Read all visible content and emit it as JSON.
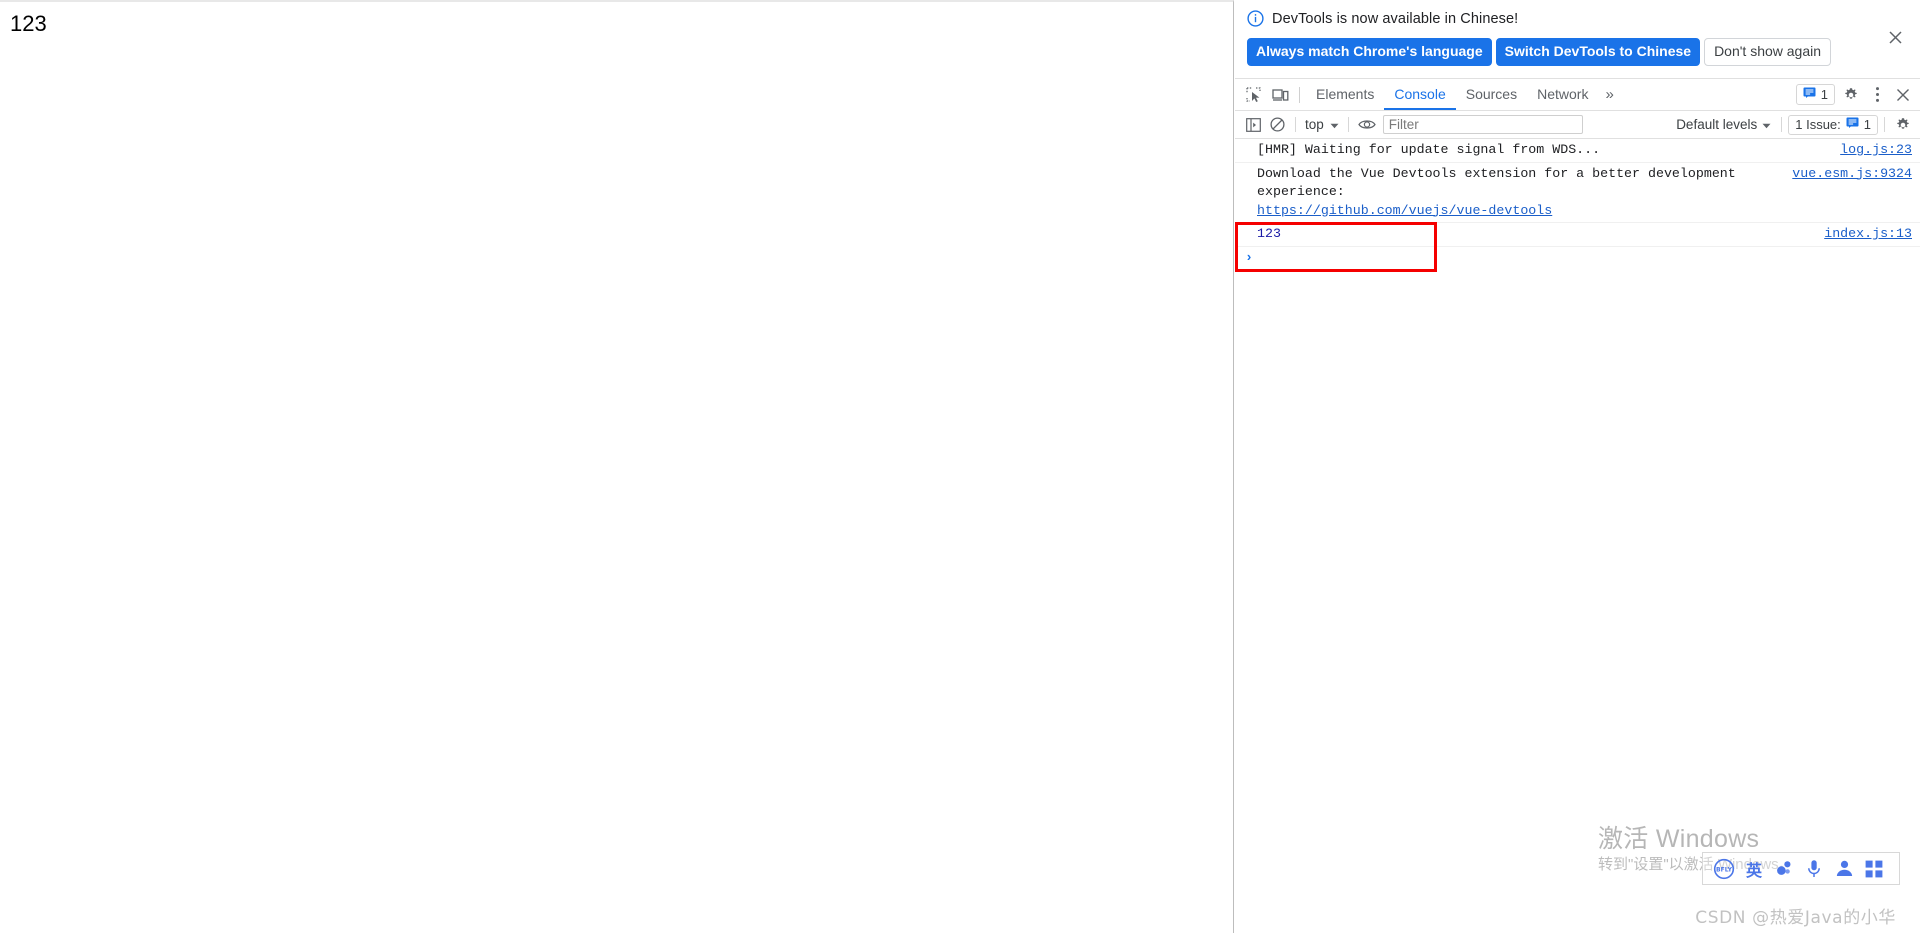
{
  "page": {
    "body_text": "123"
  },
  "banner": {
    "icon": "info-circle-icon",
    "message": "DevTools is now available in Chinese!",
    "btn_always_match": "Always match Chrome's language",
    "btn_switch": "Switch DevTools to Chinese",
    "btn_dont_show": "Don't show again",
    "close_icon": "close-icon",
    "primary_color": "#1a73e8"
  },
  "tabbar": {
    "inspect_icon": "inspect-element-icon",
    "device_icon": "device-toolbar-icon",
    "tabs": [
      {
        "label": "Elements",
        "active": false
      },
      {
        "label": "Console",
        "active": true
      },
      {
        "label": "Sources",
        "active": false
      },
      {
        "label": "Network",
        "active": false
      }
    ],
    "more_tabs_icon": "chevron-double-right-icon",
    "issues_icon": "issue-message-icon",
    "issues_count": "1",
    "settings_icon": "gear-icon",
    "more_options_icon": "three-dots-vertical-icon",
    "close_icon": "close-icon",
    "active_tab_color": "#1a73e8"
  },
  "filterbar": {
    "sidebar_icon": "console-sidebar-icon",
    "clear_icon": "clear-console-icon",
    "context": "top",
    "context_caret": "chevron-down-icon",
    "eye_icon": "live-expression-eye-icon",
    "filter_placeholder": "Filter",
    "filter_value": "",
    "levels_label": "Default levels",
    "levels_caret": "chevron-down-icon",
    "issues_label": "1 Issue:",
    "issues_icon": "issue-message-icon",
    "issues_count": "1",
    "settings_icon": "gear-icon"
  },
  "console": {
    "messages": [
      {
        "text": "[HMR] Waiting for update signal from WDS...",
        "source": "log.js:23",
        "link": null
      },
      {
        "text": "Download the Vue Devtools extension for a better development experience:",
        "source": "vue.esm.js:9324",
        "link": "https://github.com/vuejs/vue-devtools"
      },
      {
        "text": "123",
        "source": "index.js:13",
        "link": null,
        "is_number": true
      }
    ],
    "prompt_caret": "›",
    "prompt_value": "",
    "annotation_color": "#f50000"
  },
  "overlays": {
    "windows_activate_title": "激活 Windows",
    "windows_activate_sub": "转到\"设置\"以激活 Windows。",
    "ime": {
      "logo_icon": "sogou-logo-icon",
      "lang_label": "英",
      "pinwheel_icon": "input-mode-icon",
      "mic_icon": "microphone-icon",
      "person_icon": "person-icon",
      "grid_icon": "apps-grid-icon"
    },
    "csdn_watermark": "CSDN @热爱Java的小华"
  }
}
